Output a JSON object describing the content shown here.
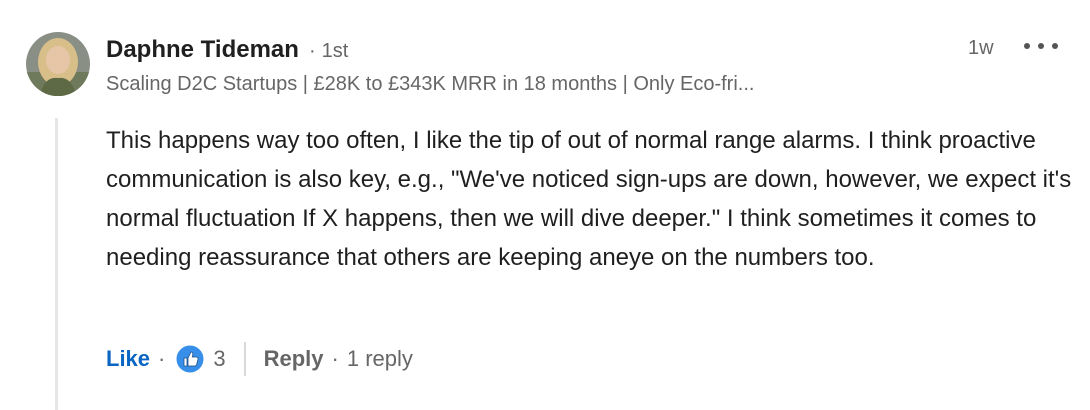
{
  "comment": {
    "author": "Daphne Tideman",
    "separator": "·",
    "connection_degree": "1st",
    "headline": "Scaling D2C Startups | £28K to £343K MRR in 18 months | Only Eco-fri...",
    "timestamp": "1w",
    "body": "This happens way too often, I like the tip of out of normal range alarms. I think proactive communication is also key, e.g., \"We've noticed sign-ups are down, however, we expect it's normal fluctuation If X happens, then we will dive deeper.\" I think sometimes it comes to needing reassurance that others are keeping aneye on the numbers too."
  },
  "actions": {
    "like_label": "Like",
    "dot": "·",
    "reaction_icon": "thumbs-up-icon",
    "reaction_count": "3",
    "reply_label": "Reply",
    "reply_count": "1 reply"
  },
  "colors": {
    "link_blue": "#0a66c2",
    "muted_text": "#666666",
    "body_text": "#1f1f1f",
    "thread_line": "#e6e6e6"
  }
}
